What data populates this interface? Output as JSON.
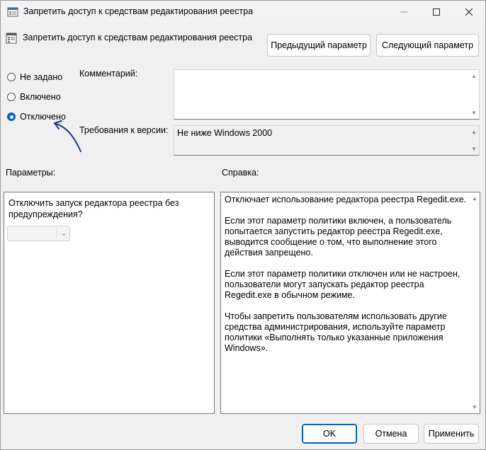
{
  "window": {
    "title": "Запретить доступ к средствам редактирования реестра"
  },
  "policy": {
    "name": "Запретить доступ к средствам редактирования реестра"
  },
  "nav": {
    "prev_label": "Предыдущий параметр",
    "next_label": "Следующий параметр"
  },
  "state": {
    "options": [
      {
        "label": "Не задано",
        "checked": false
      },
      {
        "label": "Включено",
        "checked": false
      },
      {
        "label": "Отключено",
        "checked": true
      }
    ]
  },
  "comment": {
    "label": "Комментарий:",
    "value": ""
  },
  "requirements": {
    "label": "Требования к версии:",
    "value": "Не ниже Windows 2000"
  },
  "params": {
    "label": "Параметры:",
    "option_label": "Отключить запуск редактора реестра без предупреждения?",
    "dropdown_value": ""
  },
  "help": {
    "label": "Справка:",
    "paragraphs": [
      "Отключает использование редактора реестра Regedit.exe.",
      "Если этот параметр политики включен, а пользователь попытается запустить редактор реестра Regedit.exe, выводится сообщение о том, что выполнение этого действия запрещено.",
      "Если этот параметр политики отключен или не настроен, пользователи могут запускать редактор реестра Regedit.exe в обычном режиме.",
      "Чтобы запретить пользователям использовать другие средства администрирования, используйте параметр политики «Выполнять только указанные приложения Windows»."
    ]
  },
  "footer": {
    "ok_label": "OK",
    "cancel_label": "Отмена",
    "apply_label": "Применить"
  },
  "colors": {
    "accent": "#0067c0",
    "annotation_arrow": "#1b3a8a"
  }
}
